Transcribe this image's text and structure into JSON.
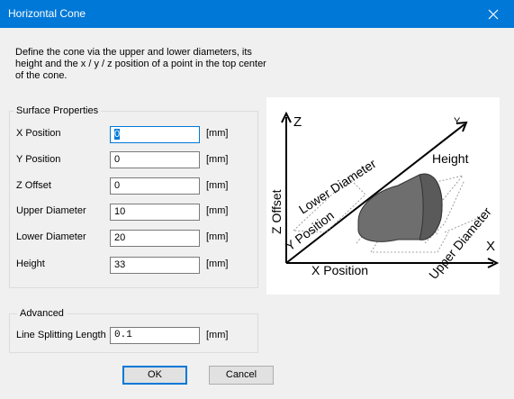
{
  "window": {
    "title": "Horizontal Cone",
    "close_icon": "close-icon"
  },
  "description": "Define the cone via the upper and lower diameters, its height and the x / y / z position of a point in the top center of the cone.",
  "surface": {
    "title": "Surface Properties",
    "fields": [
      {
        "label": "X Position",
        "value": "0",
        "unit": "[mm]"
      },
      {
        "label": "Y Position",
        "value": "0",
        "unit": "[mm]"
      },
      {
        "label": "Z Offset",
        "value": "0",
        "unit": "[mm]"
      },
      {
        "label": "Upper Diameter",
        "value": "10",
        "unit": "[mm]"
      },
      {
        "label": "Lower Diameter",
        "value": "20",
        "unit": "[mm]"
      },
      {
        "label": "Height",
        "value": "33",
        "unit": "[mm]"
      }
    ]
  },
  "advanced": {
    "title": "Advanced",
    "field": {
      "label": "Line Splitting Length",
      "value": "0.1",
      "unit": "[mm]"
    }
  },
  "buttons": {
    "ok": "OK",
    "cancel": "Cancel"
  },
  "diagram": {
    "axis_z": "Z",
    "axis_y": "Y",
    "axis_x": "X",
    "height": "Height",
    "lower_diameter": "Lower Diameter",
    "upper_diameter": "Upper Diameter",
    "z_offset": "Z Offset",
    "y_position": "Y Position",
    "x_position": "X Position"
  }
}
